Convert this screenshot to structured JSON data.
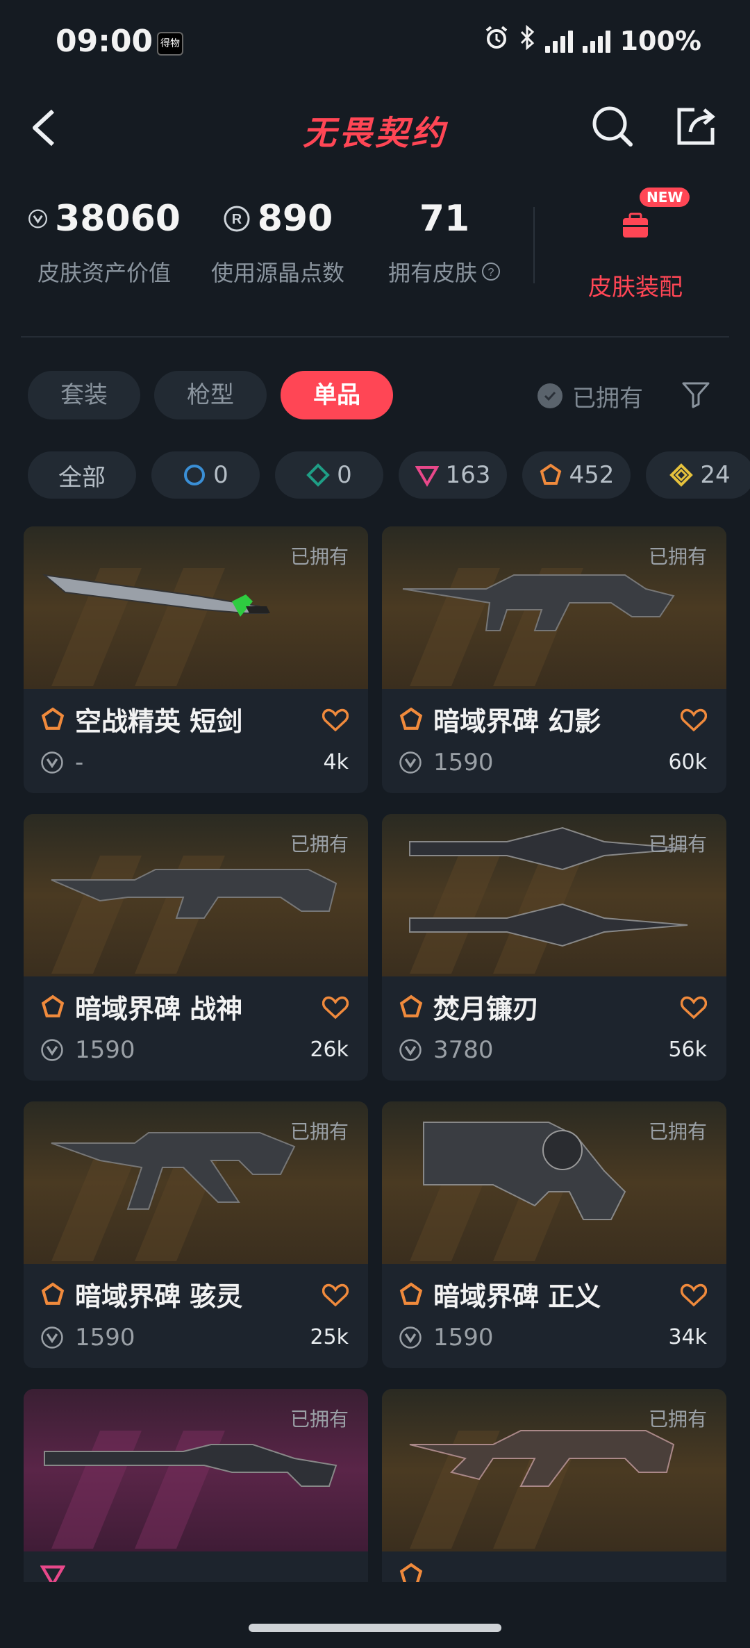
{
  "status_bar": {
    "time": "09:00",
    "app_badge": "得物",
    "battery": "100%"
  },
  "header": {
    "title": "无畏契约"
  },
  "stats": [
    {
      "value": "38060",
      "label": "皮肤资产价值",
      "icon": "vp-icon"
    },
    {
      "value": "890",
      "label": "使用源晶点数",
      "icon": "radianite-icon"
    },
    {
      "value": "71",
      "label": "拥有皮肤",
      "icon": "help-icon"
    }
  ],
  "dress": {
    "label": "皮肤装配",
    "badge": "NEW"
  },
  "tabs": [
    {
      "label": "套装",
      "active": false
    },
    {
      "label": "枪型",
      "active": false
    },
    {
      "label": "单品",
      "active": true
    }
  ],
  "owned_filter": {
    "label": "已拥有"
  },
  "chips": [
    {
      "label": "全部",
      "color": ""
    },
    {
      "label": "0",
      "color": "#3a8fd6"
    },
    {
      "label": "0",
      "color": "#1f9e86"
    },
    {
      "label": "163",
      "color": "#e8488a"
    },
    {
      "label": "452",
      "color": "#f08a3c"
    },
    {
      "label": "24",
      "color": "#e6c23c"
    }
  ],
  "items": [
    {
      "owned": "已拥有",
      "name": "空战精英 短剑",
      "price": "-",
      "likes": "4k",
      "tier_color": "#f08a3c"
    },
    {
      "owned": "已拥有",
      "name": "暗域界碑 幻影",
      "price": "1590",
      "likes": "60k",
      "tier_color": "#f08a3c"
    },
    {
      "owned": "已拥有",
      "name": "暗域界碑 战神",
      "price": "1590",
      "likes": "26k",
      "tier_color": "#f08a3c"
    },
    {
      "owned": "已拥有",
      "name": "焚月镰刃",
      "price": "3780",
      "likes": "56k",
      "tier_color": "#f08a3c"
    },
    {
      "owned": "已拥有",
      "name": "暗域界碑 骇灵",
      "price": "1590",
      "likes": "25k",
      "tier_color": "#f08a3c"
    },
    {
      "owned": "已拥有",
      "name": "暗域界碑 正义",
      "price": "1590",
      "likes": "34k",
      "tier_color": "#f08a3c"
    },
    {
      "owned": "已拥有",
      "name": "",
      "price": "",
      "likes": "",
      "tier_color": "#e8488a"
    },
    {
      "owned": "已拥有",
      "name": "",
      "price": "",
      "likes": "",
      "tier_color": "#f08a3c"
    }
  ],
  "colors": {
    "accent": "#ff4655",
    "background": "#151b22",
    "card": "#1d242d"
  }
}
